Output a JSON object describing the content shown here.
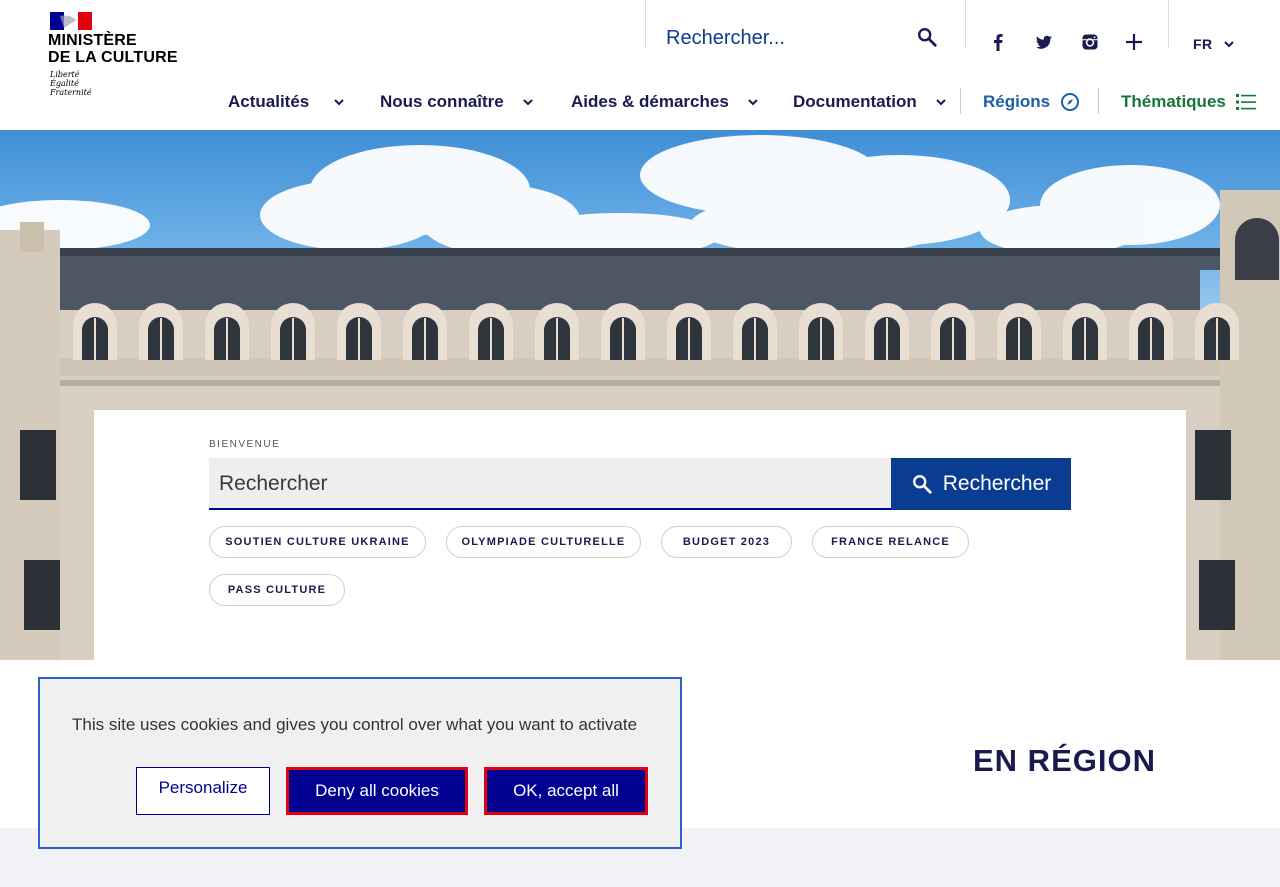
{
  "header": {
    "logo": {
      "line1": "MINISTÈRE",
      "line2": "DE LA CULTURE",
      "motto": [
        "Liberté",
        "Égalité",
        "Fraternité"
      ]
    },
    "search_placeholder": "Rechercher...",
    "socials": [
      "facebook-icon",
      "twitter-icon",
      "instagram-icon",
      "plus-icon"
    ],
    "language": "FR"
  },
  "nav": {
    "items": [
      {
        "label": "Actualités"
      },
      {
        "label": "Nous connaître"
      },
      {
        "label": "Aides & démarches"
      },
      {
        "label": "Documentation"
      },
      {
        "label": "Régions"
      },
      {
        "label": "Thématiques"
      }
    ]
  },
  "welcome": {
    "kicker": "BIENVENUE",
    "search_placeholder": "Rechercher",
    "search_button": "Rechercher",
    "chips": [
      "SOUTIEN CULTURE UKRAINE",
      "OLYMPIADE CULTURELLE",
      "BUDGET 2023",
      "FRANCE RELANCE",
      "PASS CULTURE"
    ]
  },
  "region_title": "EN RÉGION",
  "cookie": {
    "message": "This site uses cookies and gives you control over what you want to activate",
    "personalize": "Personalize",
    "deny": "Deny all cookies",
    "accept": "OK, accept all"
  },
  "colors": {
    "brand_blue": "#000091",
    "nav_text": "#1a1a50",
    "accent_green": "#18753c",
    "highlight_red": "#e1000f"
  }
}
